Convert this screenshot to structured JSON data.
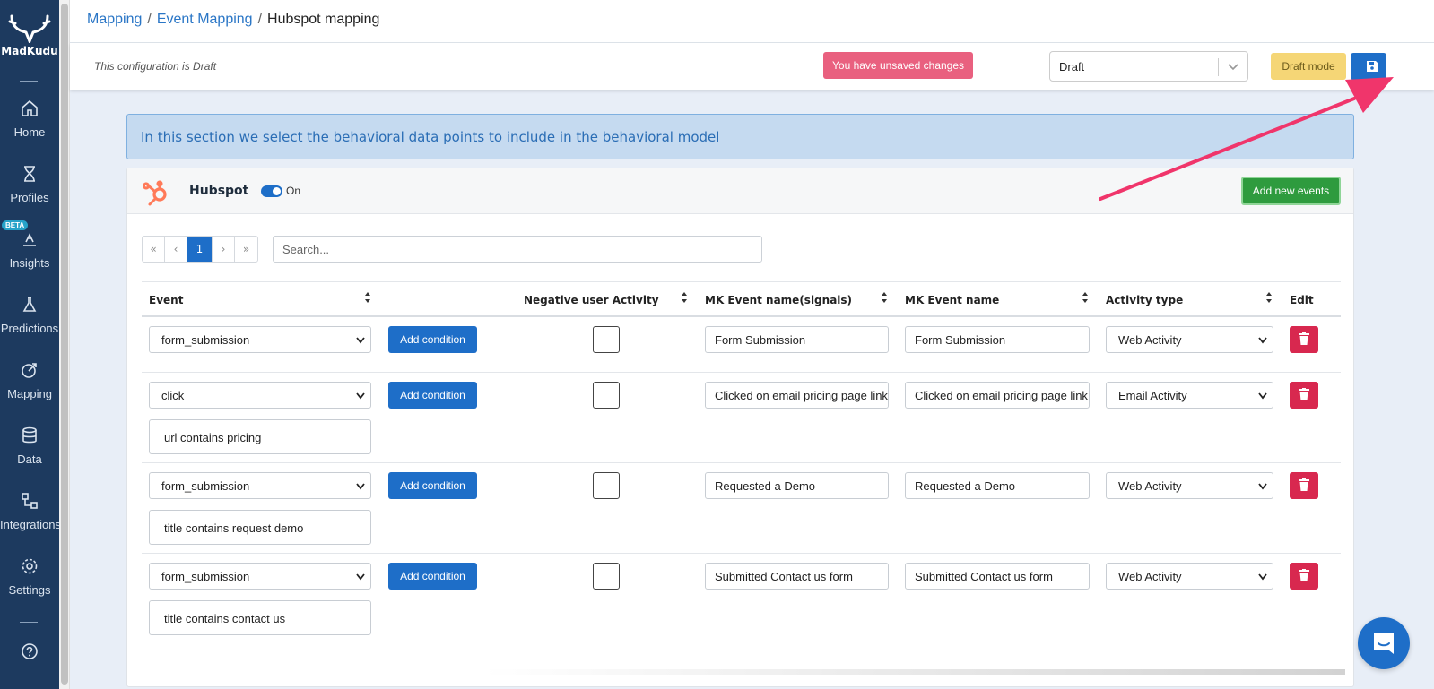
{
  "sidebar": {
    "logo_text": "MadKudu",
    "items": [
      {
        "label": "Home",
        "icon": "home-icon"
      },
      {
        "label": "Profiles",
        "icon": "hourglass-icon"
      },
      {
        "label": "Insights",
        "icon": "insights-icon",
        "badge": "BETA"
      },
      {
        "label": "Predictions",
        "icon": "flask-icon"
      },
      {
        "label": "Mapping",
        "icon": "mapping-icon"
      },
      {
        "label": "Data",
        "icon": "database-icon"
      },
      {
        "label": "Integrations",
        "icon": "integrations-icon"
      },
      {
        "label": "Settings",
        "icon": "gear-icon"
      }
    ]
  },
  "breadcrumb": {
    "items": [
      "Mapping",
      "Event Mapping"
    ],
    "current": "Hubspot mapping",
    "separator": "/"
  },
  "toolbar": {
    "draft_note": "This configuration is Draft",
    "unsaved_label": "You have unsaved changes",
    "status_value": "Draft",
    "draft_mode_label": "Draft mode"
  },
  "info_banner": "In this section we select the behavioral data points to include in the behavioral model",
  "integration": {
    "name": "Hubspot",
    "toggle_label": "On",
    "add_events_label": "Add new events"
  },
  "pager": {
    "first": "«",
    "prev": "‹",
    "current": "1",
    "next": "›",
    "last": "»"
  },
  "search": {
    "placeholder": "Search..."
  },
  "table": {
    "headers": {
      "event": "Event",
      "negative": "Negative user Activity",
      "signal_name": "MK Event name(signals)",
      "event_name": "MK Event name",
      "activity_type": "Activity type",
      "edit": "Edit"
    },
    "add_condition_label": "Add condition",
    "rows": [
      {
        "event": "form_submission",
        "signal_name": "Form Submission",
        "event_name": "Form Submission",
        "activity_type": "Web Activity",
        "condition": ""
      },
      {
        "event": "click",
        "signal_name": "Clicked on email pricing page link",
        "event_name": "Clicked on email pricing page link",
        "activity_type": "Email Activity",
        "condition": "url contains pricing"
      },
      {
        "event": "form_submission",
        "signal_name": "Requested a Demo",
        "event_name": "Requested a Demo",
        "activity_type": "Web Activity",
        "condition": "title contains request demo"
      },
      {
        "event": "form_submission",
        "signal_name": "Submitted Contact us form",
        "event_name": "Submitted Contact us form",
        "activity_type": "Web Activity",
        "condition": "title contains contact us"
      }
    ]
  },
  "colors": {
    "sidebar": "#1d3a5f",
    "primary": "#1e6ec8",
    "success": "#2e9b3e",
    "danger": "#d8284f",
    "warning": "#f5d676",
    "arrow": "#f0356b"
  }
}
